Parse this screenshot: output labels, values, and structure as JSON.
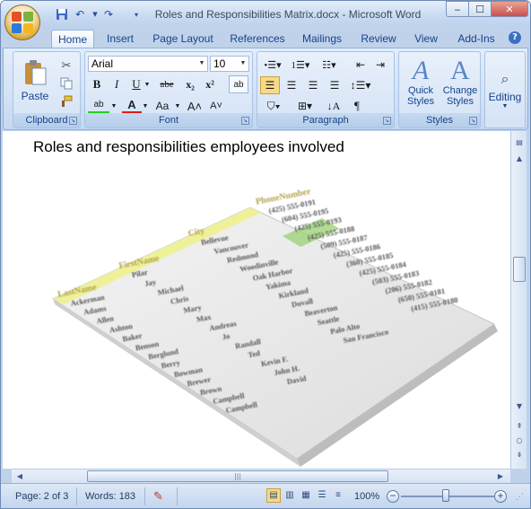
{
  "window": {
    "title": "Roles and Responsibilities Matrix.docx - Microsoft Word",
    "minimize": "‒",
    "maximize": "☐",
    "close": "✕"
  },
  "tabs": [
    "Home",
    "Insert",
    "Page Layout",
    "References",
    "Mailings",
    "Review",
    "View",
    "Add-Ins"
  ],
  "ribbon": {
    "clipboard": {
      "label": "Clipboard",
      "paste": "Paste"
    },
    "font": {
      "label": "Font",
      "font_name": "Arial",
      "font_size": "10",
      "bold": "B",
      "italic": "I",
      "underline": "U",
      "strike": "abe",
      "subscript": "x₂",
      "superscript": "x²",
      "grow": "A˄",
      "shrink": "A˅",
      "case": "Aa"
    },
    "paragraph": {
      "label": "Paragraph"
    },
    "styles": {
      "label": "Styles",
      "quick_styles": "Quick Styles",
      "change_styles": "Change Styles"
    },
    "editing": {
      "label": "Editing"
    }
  },
  "document": {
    "heading": "Roles and responsibilities employees involved",
    "table_image": {
      "headers": [
        "LastName",
        "FirstName",
        "City",
        "PhoneNumber"
      ],
      "rows": [
        [
          "Ackerman",
          "Pilar",
          "Bellevue",
          "(425) 555-0191"
        ],
        [
          "Adams",
          "Jay",
          "Vancouver",
          "(604) 555-0195"
        ],
        [
          "Allen",
          "Michael",
          "Redmond",
          "(425) 555-0193"
        ],
        [
          "Ashton",
          "Chris",
          "Woodinville",
          "(425) 555-0188"
        ],
        [
          "Baker",
          "Mary",
          "Oak Harbor",
          "(509) 555-0187"
        ],
        [
          "Benson",
          "Max",
          "Yakima",
          "(425) 555-0186"
        ],
        [
          "Berglund",
          "Andreas",
          "Kirkland",
          "(360) 555-0185"
        ],
        [
          "Berry",
          "Jo",
          "Duvall",
          "(425) 555-0184"
        ],
        [
          "Bowman",
          "Randall",
          "Beaverton",
          "(503) 555-0183"
        ],
        [
          "Brewer",
          "Ted",
          "Seattle",
          "(206) 555-0182"
        ],
        [
          "Brown",
          "Kevin F.",
          "Palo Alto",
          "(650) 555-0181"
        ],
        [
          "Campbell",
          "John H.",
          "San Francisco",
          "(415) 555-0180"
        ],
        [
          "Campbell",
          "David",
          "",
          ""
        ]
      ]
    }
  },
  "status": {
    "page": "Page: 2 of 3",
    "words": "Words: 183",
    "zoom": "100%",
    "zoom_level_percent": 100
  }
}
